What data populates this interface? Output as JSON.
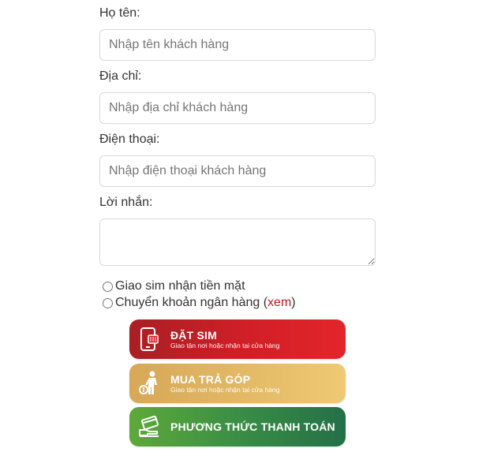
{
  "form": {
    "name_label": "Họ tên:",
    "name_placeholder": "Nhập tên khách hàng",
    "address_label": "Địa chỉ:",
    "address_placeholder": "Nhập địa chỉ khách hàng",
    "phone_label": "Điện thoại:",
    "phone_placeholder": "Nhập điện thoại khách hàng",
    "message_label": "Lời nhắn:",
    "message_value": ""
  },
  "payment": {
    "option_cash": "Giao sim nhận tiền mặt",
    "option_transfer": "Chuyển khoản ngân hàng (",
    "option_transfer_link": "xem",
    "option_transfer_close": ")"
  },
  "buttons": {
    "order": {
      "title": "ĐẶT SIM",
      "subtitle": "Giao tận nơi hoặc nhận tại cửa hàng",
      "icon": "phone-sim-icon"
    },
    "installment": {
      "title": "MUA TRẢ GÓP",
      "subtitle": "Giao tận nơi hoặc nhận tại cửa hàng",
      "icon": "person-money-icon"
    },
    "payment_method": {
      "title": "PHƯƠNG THỨC THANH TOÁN",
      "icon": "card-hand-icon"
    }
  },
  "colors": {
    "order_button": "#d11f27",
    "installment_button": "#e2b865",
    "payment_button": "#3a8e45",
    "link": "#c0171e"
  }
}
